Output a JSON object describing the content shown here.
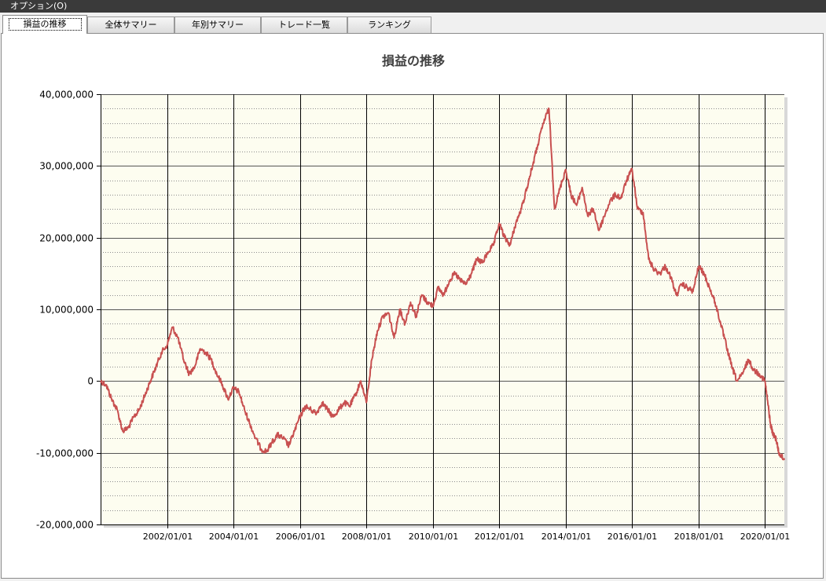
{
  "menu": {
    "options_label": "オプション(O)"
  },
  "tabs": [
    {
      "label": "損益の推移",
      "active": true
    },
    {
      "label": "全体サマリー",
      "active": false
    },
    {
      "label": "年別サマリー",
      "active": false
    },
    {
      "label": "トレード一覧",
      "active": false
    },
    {
      "label": "ランキング",
      "active": false
    }
  ],
  "colors": {
    "plot_background": "#fdfdf0",
    "series_line": "#c85050",
    "menubar": "#3a3a3a"
  },
  "chart_data": {
    "type": "line",
    "title": "損益の推移",
    "xlabel": "",
    "ylabel": "",
    "ylim": [
      -20000000,
      40000000
    ],
    "xlim": [
      "2000/01/01",
      "2020/08/01"
    ],
    "y_ticks": [
      "40,000,000",
      "30,000,000",
      "20,000,000",
      "10,000,000",
      "0",
      "-10,000,000",
      "-20,000,000"
    ],
    "y_tick_values": [
      40000000,
      30000000,
      20000000,
      10000000,
      0,
      -10000000,
      -20000000
    ],
    "x_ticks": [
      "2002/01/01",
      "2004/01/01",
      "2006/01/01",
      "2008/01/01",
      "2010/01/01",
      "2012/01/01",
      "2014/01/01",
      "2016/01/01",
      "2018/01/01",
      "2020/01/01"
    ],
    "grid": true,
    "legend": "none",
    "series": [
      {
        "x": [
          "2000/01/01",
          "2000/03/01",
          "2000/05/01",
          "2000/07/01",
          "2000/09/01",
          "2000/11/01",
          "2001/01/01",
          "2001/03/01",
          "2001/05/01",
          "2001/07/01",
          "2001/09/01",
          "2001/11/01",
          "2002/01/01",
          "2002/03/01",
          "2002/05/01",
          "2002/07/01",
          "2002/09/01",
          "2002/11/01",
          "2003/01/01",
          "2003/03/01",
          "2003/05/01",
          "2003/07/01",
          "2003/09/01",
          "2003/11/01",
          "2004/01/01",
          "2004/03/01",
          "2004/05/01",
          "2004/07/01",
          "2004/09/01",
          "2004/11/01",
          "2005/01/01",
          "2005/03/01",
          "2005/05/01",
          "2005/07/01",
          "2005/09/01",
          "2005/11/01",
          "2006/01/01",
          "2006/03/01",
          "2006/05/01",
          "2006/07/01",
          "2006/09/01",
          "2006/11/01",
          "2007/01/01",
          "2007/03/01",
          "2007/05/01",
          "2007/07/01",
          "2007/09/01",
          "2007/11/01",
          "2008/01/01",
          "2008/03/01",
          "2008/05/01",
          "2008/07/01",
          "2008/09/01",
          "2008/11/01",
          "2009/01/01",
          "2009/03/01",
          "2009/05/01",
          "2009/07/01",
          "2009/09/01",
          "2009/11/01",
          "2010/01/01",
          "2010/03/01",
          "2010/05/01",
          "2010/07/01",
          "2010/09/01",
          "2010/11/01",
          "2011/01/01",
          "2011/03/01",
          "2011/05/01",
          "2011/07/01",
          "2011/09/01",
          "2011/11/01",
          "2012/01/01",
          "2012/03/01",
          "2012/05/01",
          "2012/07/01",
          "2012/09/01",
          "2012/11/01",
          "2013/01/01",
          "2013/03/01",
          "2013/05/01",
          "2013/07/01",
          "2013/09/01",
          "2013/11/01",
          "2014/01/01",
          "2014/03/01",
          "2014/05/01",
          "2014/07/01",
          "2014/09/01",
          "2014/11/01",
          "2015/01/01",
          "2015/03/01",
          "2015/05/01",
          "2015/07/01",
          "2015/09/01",
          "2015/11/01",
          "2016/01/01",
          "2016/03/01",
          "2016/05/01",
          "2016/07/01",
          "2016/09/01",
          "2016/11/01",
          "2017/01/01",
          "2017/03/01",
          "2017/05/01",
          "2017/07/01",
          "2017/09/01",
          "2017/11/01",
          "2018/01/01",
          "2018/03/01",
          "2018/05/01",
          "2018/07/01",
          "2018/09/01",
          "2018/11/01",
          "2019/01/01",
          "2019/03/01",
          "2019/05/01",
          "2019/07/01",
          "2019/09/01",
          "2019/11/01",
          "2020/01/01",
          "2020/02/01",
          "2020/03/01",
          "2020/04/01",
          "2020/05/01",
          "2020/06/01",
          "2020/07/01",
          "2020/08/01"
        ],
        "values": [
          0,
          -500000,
          -2500000,
          -4000000,
          -7000000,
          -6500000,
          -5000000,
          -4000000,
          -2000000,
          0,
          2000000,
          4000000,
          5000000,
          7500000,
          6000000,
          3000000,
          1000000,
          2000000,
          4500000,
          4000000,
          3000000,
          1000000,
          -500000,
          -2500000,
          -1000000,
          -1500000,
          -4000000,
          -6000000,
          -8000000,
          -9500000,
          -9800000,
          -8500000,
          -7500000,
          -8000000,
          -9000000,
          -7000000,
          -5000000,
          -3500000,
          -4000000,
          -4500000,
          -3000000,
          -4000000,
          -5000000,
          -4000000,
          -3000000,
          -3500000,
          -2000000,
          0,
          -3000000,
          3000000,
          7000000,
          9000000,
          9500000,
          6000000,
          10000000,
          8000000,
          11000000,
          9000000,
          12000000,
          11000000,
          10500000,
          13000000,
          12000000,
          14000000,
          15000000,
          14000000,
          13500000,
          15000000,
          17000000,
          16500000,
          18000000,
          19000000,
          22000000,
          20000000,
          19000000,
          22000000,
          24000000,
          27000000,
          30000000,
          33000000,
          36000000,
          38000000,
          24000000,
          27000000,
          29500000,
          26000000,
          24500000,
          27000000,
          23000000,
          24000000,
          21000000,
          23000000,
          25000000,
          26000000,
          25500000,
          28000000,
          29500000,
          24000000,
          23500000,
          17000000,
          15500000,
          15000000,
          16000000,
          14500000,
          12000000,
          13500000,
          13000000,
          12500000,
          16000000,
          15000000,
          13000000,
          11000000,
          8000000,
          5000000,
          2000000,
          0,
          1000000,
          3000000,
          1500000,
          1000000,
          0,
          -3000000,
          -6000000,
          -7500000,
          -8000000,
          -10000000,
          -10500000,
          -11000000
        ]
      }
    ]
  }
}
